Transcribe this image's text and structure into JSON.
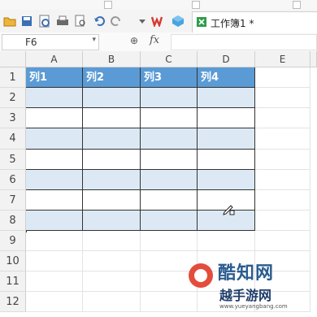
{
  "titlebar": {
    "doc_tab_label": "工作簿1 *"
  },
  "toolbar_icons": [
    "folder-icon",
    "save-icon",
    "save-as-icon",
    "print-icon",
    "print-preview-icon",
    "undo-icon",
    "redo-icon",
    "dropdown-icon",
    "wps-logo-icon",
    "cube-icon",
    "spreadsheet-icon"
  ],
  "formula_bar": {
    "name_box": "F6",
    "zoom_icon": "⊕",
    "fx_label": "fx",
    "formula_value": ""
  },
  "columns": [
    "A",
    "B",
    "C",
    "D",
    "E"
  ],
  "rows": [
    "1",
    "2",
    "3",
    "4",
    "5",
    "6",
    "7",
    "8",
    "9",
    "10",
    "11",
    "12"
  ],
  "table": {
    "headers": [
      "列1",
      "列2",
      "列3",
      "列4"
    ],
    "header_color": "#5b9bd5",
    "band_color": "#dce9f5"
  },
  "watermark": {
    "brand": "酷知网",
    "sub": "越手游网",
    "url": "www.yueyangbang.com"
  }
}
